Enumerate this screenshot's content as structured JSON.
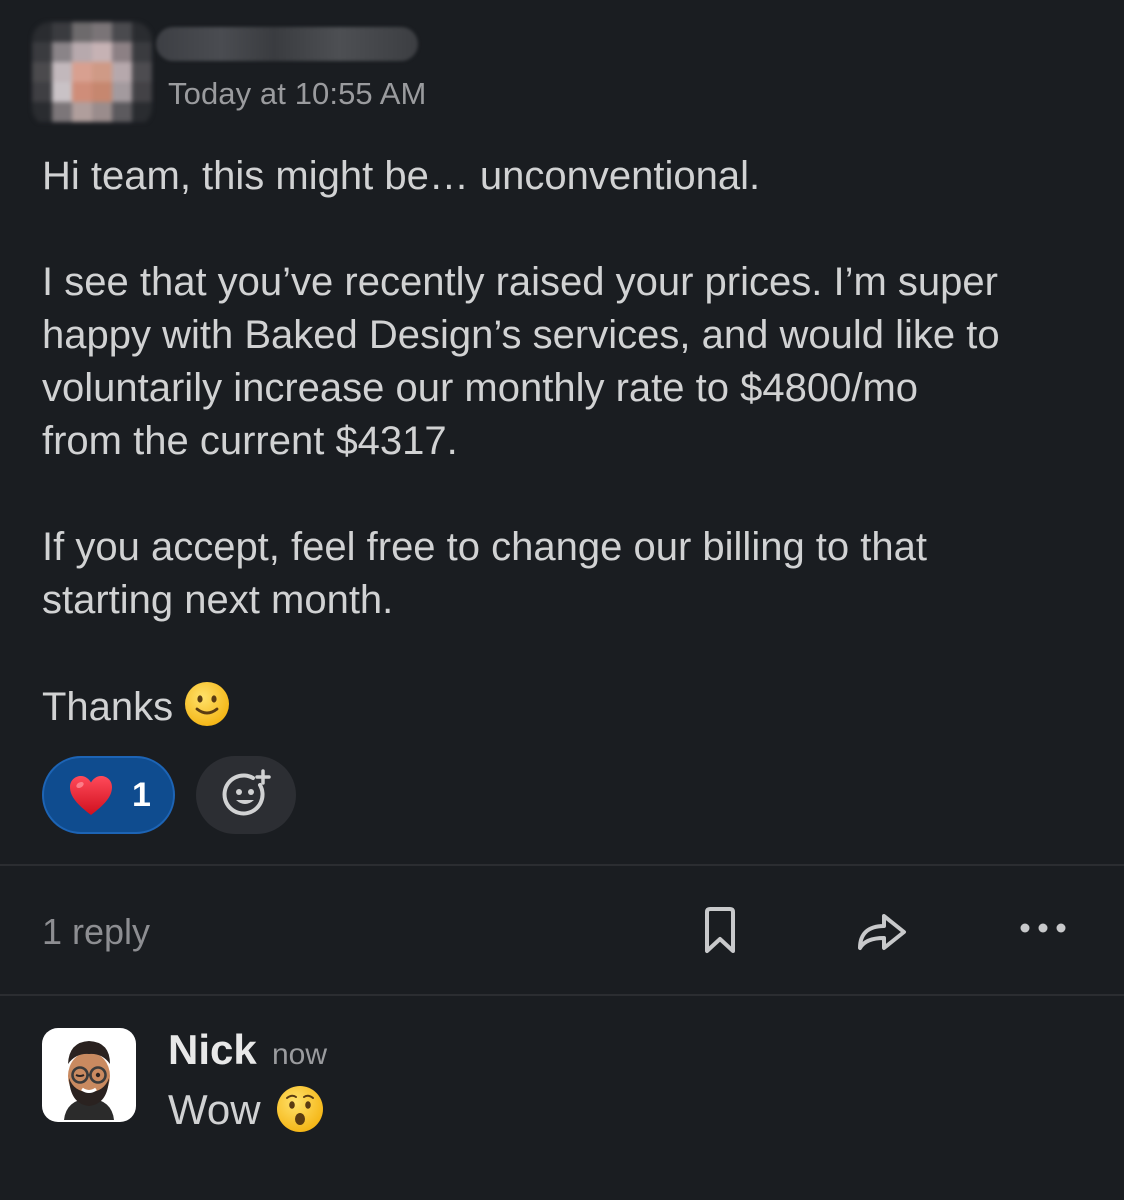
{
  "message": {
    "author_name": "",
    "timestamp": "Today at 10:55 AM",
    "paragraphs": [
      "Hi team, this might be… unconventional.",
      "I see that you’ve recently raised your prices. I’m super\nhappy with Baked Design’s services, and would like to\nvoluntarily increase our monthly rate to $4800/mo\nfrom the current $4317.",
      "If you accept, feel free to change our billing to that\nstarting next month."
    ],
    "closing": "Thanks",
    "closing_emoji": "slightly-smiling-face"
  },
  "reactions": [
    {
      "emoji": "red-heart",
      "count": "1",
      "selected": true
    }
  ],
  "add_reaction_icon": "add-reaction-icon",
  "actions": {
    "reply_count": "1 reply",
    "icons": [
      "bookmark-icon",
      "share-icon",
      "more-icon"
    ]
  },
  "reply": {
    "author_name": "Nick",
    "timestamp": "now",
    "text": "Wow",
    "emoji": "hushed-face"
  },
  "colors": {
    "background": "#1a1d21",
    "reaction_selected_bg": "#0f4c8f",
    "reaction_selected_border": "#1d64b5",
    "text": "#d1d2d3",
    "muted": "#9a9b9e"
  }
}
